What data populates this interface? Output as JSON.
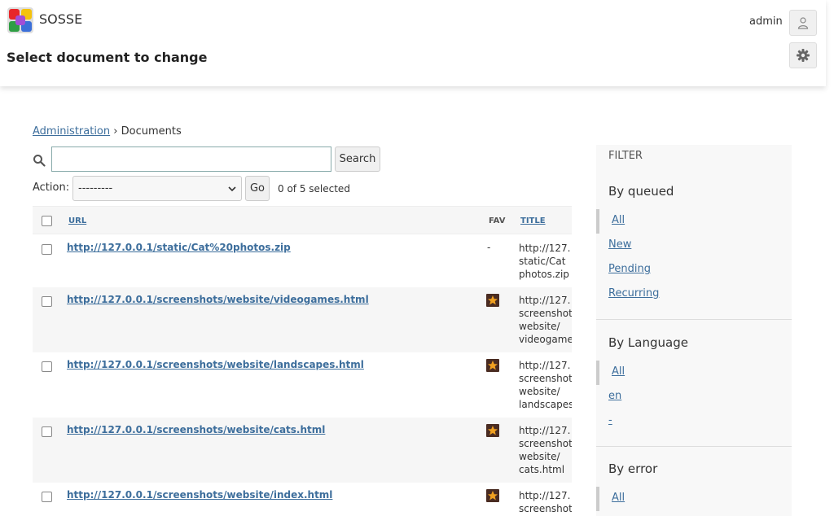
{
  "header": {
    "brand": "SOSSE",
    "page_title": "Select document to change",
    "user": "admin"
  },
  "breadcrumb": {
    "home": "Administration",
    "separator": "›",
    "current": "Documents"
  },
  "search": {
    "value": "",
    "placeholder": "",
    "button": "Search"
  },
  "actions": {
    "label": "Action:",
    "selected": "---------",
    "go": "Go",
    "counter": "0 of 5 selected"
  },
  "table": {
    "columns": [
      "URL",
      "FAV",
      "TITLE"
    ],
    "rows": [
      {
        "url": "http://127.0.0.1/static/Cat%20photos.zip",
        "fav": "-",
        "title_lines": [
          "http://127.",
          "static/Cat",
          "photos.zip"
        ]
      },
      {
        "url": "http://127.0.0.1/screenshots/website/videogames.html",
        "fav": "icon",
        "title_lines": [
          "http://127.",
          "screenshot",
          "website/",
          "videogame"
        ]
      },
      {
        "url": "http://127.0.0.1/screenshots/website/landscapes.html",
        "fav": "icon",
        "title_lines": [
          "http://127.",
          "screenshot",
          "website/",
          "landscapes"
        ]
      },
      {
        "url": "http://127.0.0.1/screenshots/website/cats.html",
        "fav": "icon",
        "title_lines": [
          "http://127.",
          "screenshot",
          "website/",
          "cats.html"
        ]
      },
      {
        "url": "http://127.0.0.1/screenshots/website/index.html",
        "fav": "icon",
        "title_lines": [
          "http://127.",
          "screenshot"
        ]
      }
    ]
  },
  "filter": {
    "heading": "Filter",
    "groups": [
      {
        "title": "By queued",
        "items": [
          "All",
          "New",
          "Pending",
          "Recurring"
        ]
      },
      {
        "title": "By Language",
        "items": [
          "All",
          "en",
          "-"
        ]
      },
      {
        "title": "By error",
        "items": [
          "All"
        ]
      }
    ]
  },
  "colors": {
    "link": "#3d6e9c",
    "row_alt": "#f6f6f6",
    "favicon_bg": "#4a2c22",
    "favicon_star": "#f0a020"
  }
}
